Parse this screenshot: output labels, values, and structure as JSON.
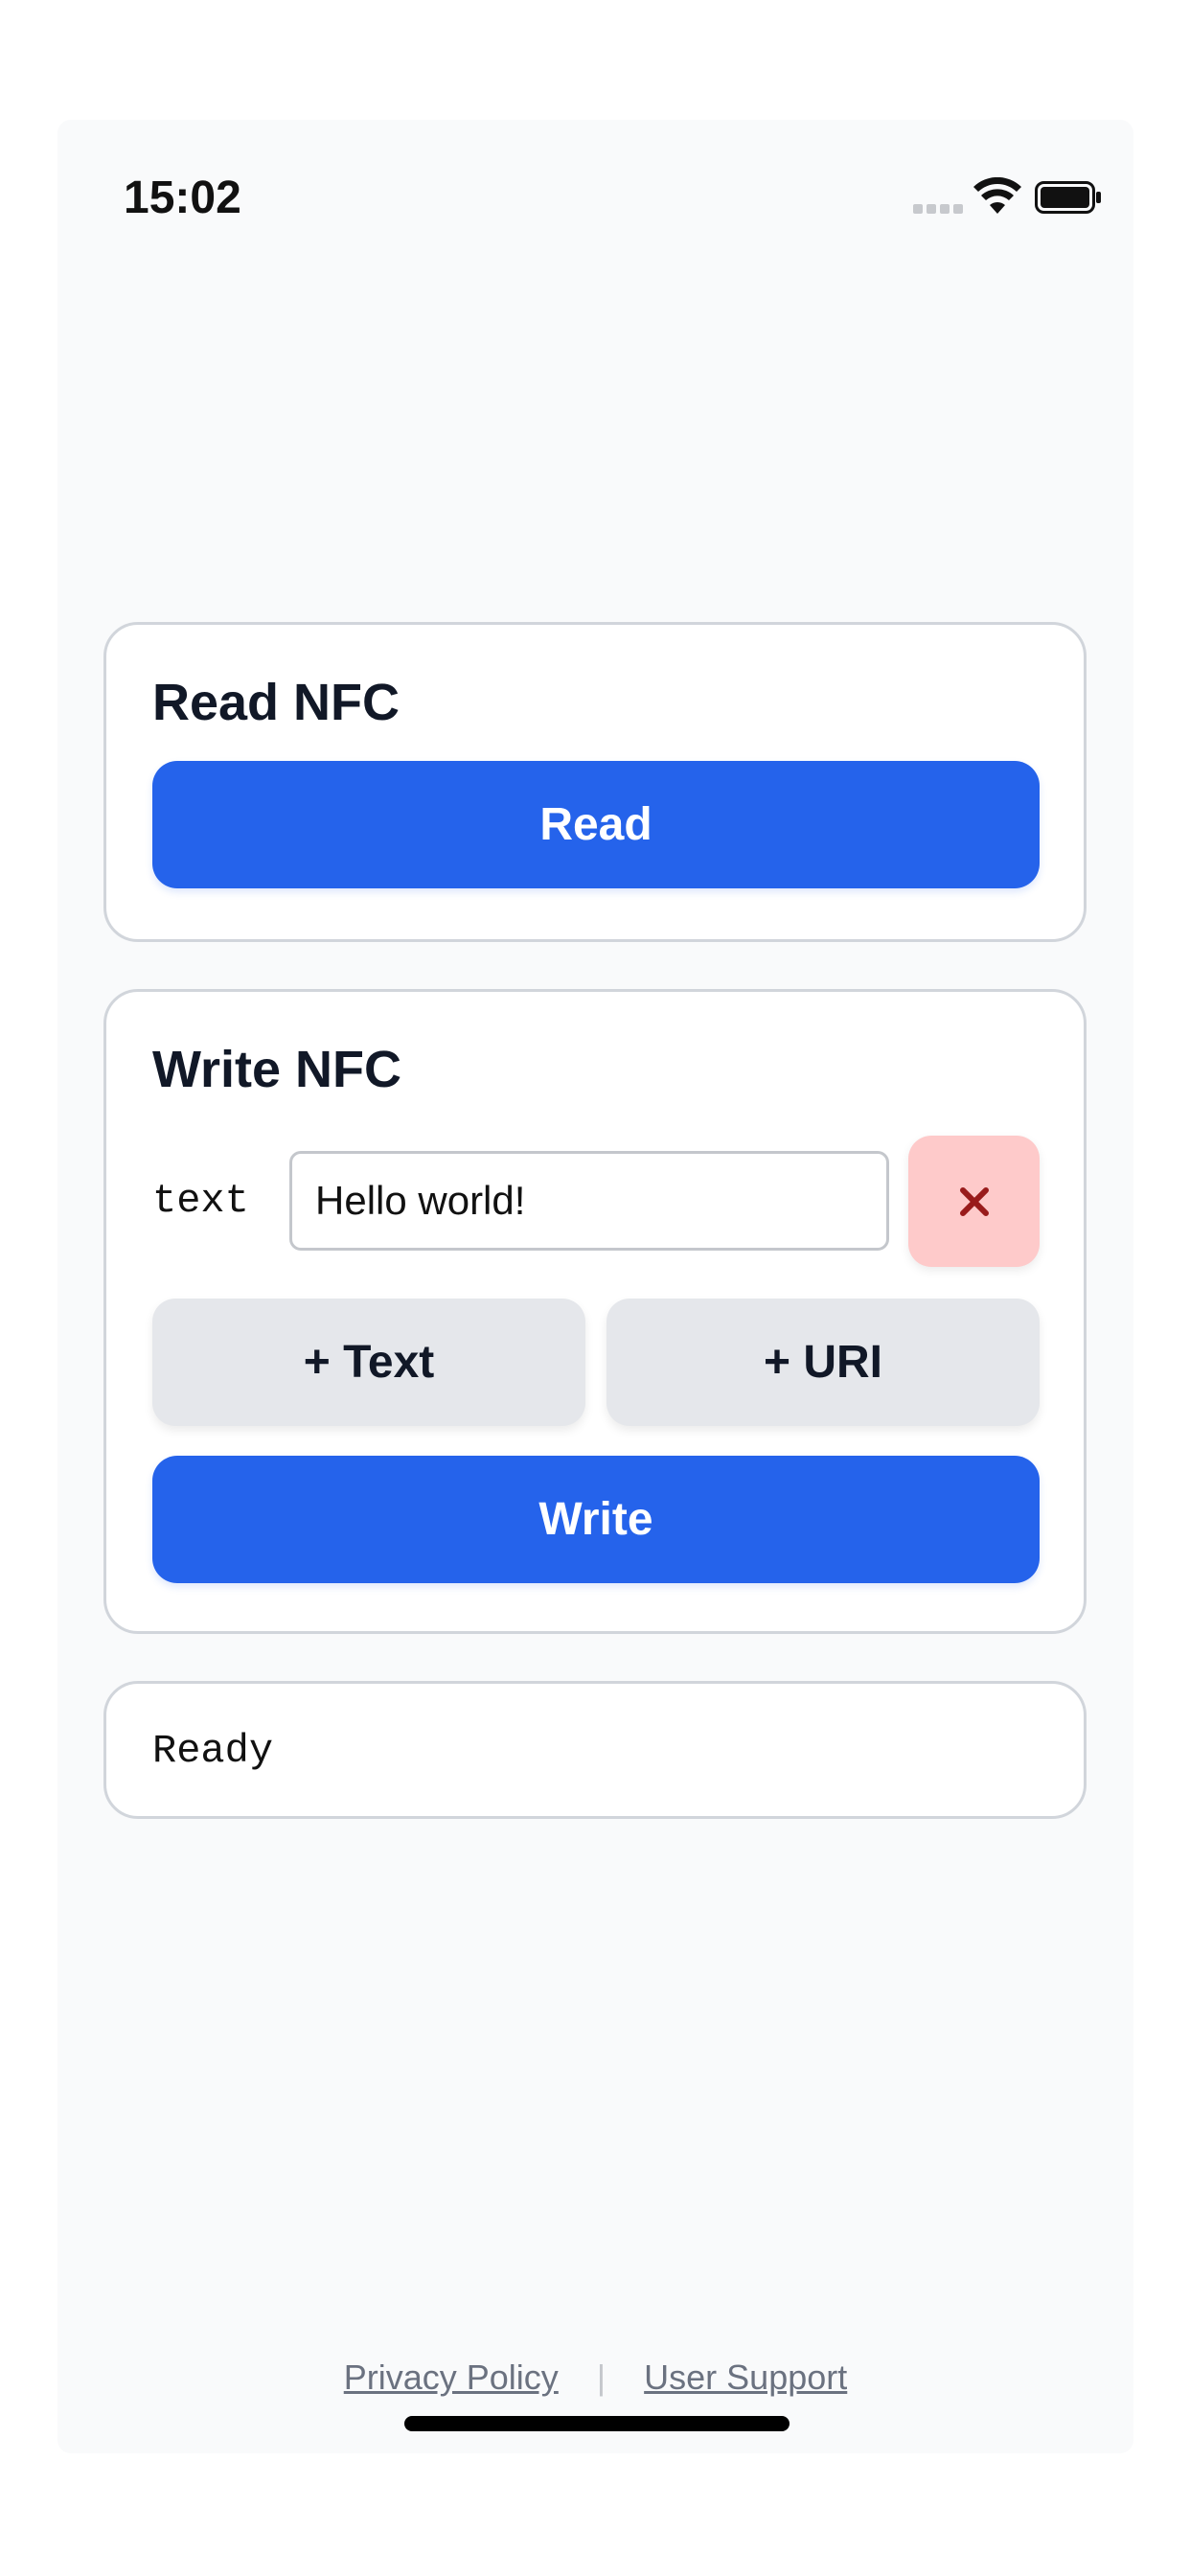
{
  "status_bar": {
    "time": "15:02",
    "signal_icon": "cellular-signal-icon",
    "wifi_icon": "wifi-icon",
    "battery_icon": "battery-icon"
  },
  "read_card": {
    "title": "Read NFC",
    "read_button_label": "Read"
  },
  "write_card": {
    "title": "Write NFC",
    "record": {
      "type_label": "text",
      "value": "Hello world!",
      "remove_icon": "close-icon"
    },
    "add_text_label": "+ Text",
    "add_uri_label": "+ URI",
    "write_button_label": "Write"
  },
  "status": {
    "text": "Ready"
  },
  "footer": {
    "privacy_label": "Privacy Policy",
    "separator": "|",
    "support_label": "User Support"
  },
  "colors": {
    "primary": "#2563eb",
    "secondary": "#e5e7eb",
    "danger_bg": "#fecaca",
    "danger_fg": "#991b1b",
    "background": "#f9fafb"
  }
}
